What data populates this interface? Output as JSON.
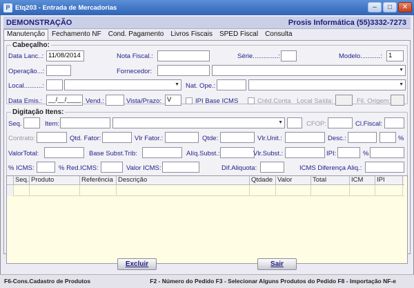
{
  "window": {
    "title": "Etq203 - Entrada de Mercadorias",
    "icon_letter": "P"
  },
  "header": {
    "left": "DEMONSTRAÇÃO",
    "right": "Prosis Informática (55)3332-7273"
  },
  "tabs": [
    "Manutenção",
    "Fechamento NF",
    "Cond. Pagamento",
    "Livros Fiscais",
    "SPED Fiscal",
    "Consulta"
  ],
  "cabecalho": {
    "title": "Cabeçalho:",
    "data_lanc_label": "Data Lanc..:",
    "data_lanc_value": "11/08/2014",
    "nota_fiscal_label": "Nota Fiscal.:",
    "serie_label": "Série..............:",
    "modelo_label": "Modelo...........:",
    "modelo_value": "1",
    "operacao_label": "Operação...:",
    "fornecedor_label": "Fornecedor:",
    "local_label": "Local..........:",
    "nat_ope_label": "Nat. Ope.:",
    "data_emis_label": "Data Emis.:",
    "data_emis_value": "__/__/____",
    "vend_label": "Vend.:",
    "vista_prazo_label": "Vista/Prazo:",
    "vista_prazo_value": "V",
    "ipi_base_icms_label": "IPI Base ICMS",
    "cred_conta_label": "Créd.Conta",
    "local_saida_label": "Local Saída:",
    "fil_origem_label": "Fil. Origem:"
  },
  "itens": {
    "title": "Digitação Itens:",
    "seq_label": "Seq.",
    "item_label": "Item:",
    "cfop_label": "CFOP:",
    "cl_fiscal_label": "Cl.Fiscal:",
    "contrato_label": "Contrato:",
    "qtd_fator_label": "Qtd. Fator:",
    "vlr_fator_label": "Vlr Fator.:",
    "qtde_label": "Qtde:",
    "vlr_unit_label": "Vlr.Unit.:",
    "desc_label": "Desc.:",
    "pct_symbol": "%",
    "valor_total_label": "ValorTotal:",
    "base_subst_label": "Base Subst.Trib:",
    "aliq_subst_label": "Alíq.Subst.:",
    "vlr_subst_label": "Vlr.Subst.:",
    "ipi_label": "IPI:",
    "pct_symbol2": "%",
    "pct_icms_label": "% ICMS:",
    "pct_red_icms_label": "% Red.ICMS:",
    "valor_icms_label": "Valor ICMS:",
    "dif_aliquota_label": "Dif.Aliquota:",
    "icms_dif_aliq_label": "ICMS Diferença Aliq.:"
  },
  "grid": {
    "columns": [
      "Seq.",
      "Produto",
      "Referência",
      "Descrição",
      "Qtdade",
      "Valor",
      "Total",
      "ICM",
      "IPI"
    ]
  },
  "buttons": {
    "excluir": "Excluir",
    "sair": "Sair"
  },
  "statusbar": {
    "left": "F6-Cons.Cadastro de Produtos",
    "right": "F2 - Número do Pedido  F3 - Selecionar Alguns Produtos do Pedido F8 - Importação NF-e"
  }
}
